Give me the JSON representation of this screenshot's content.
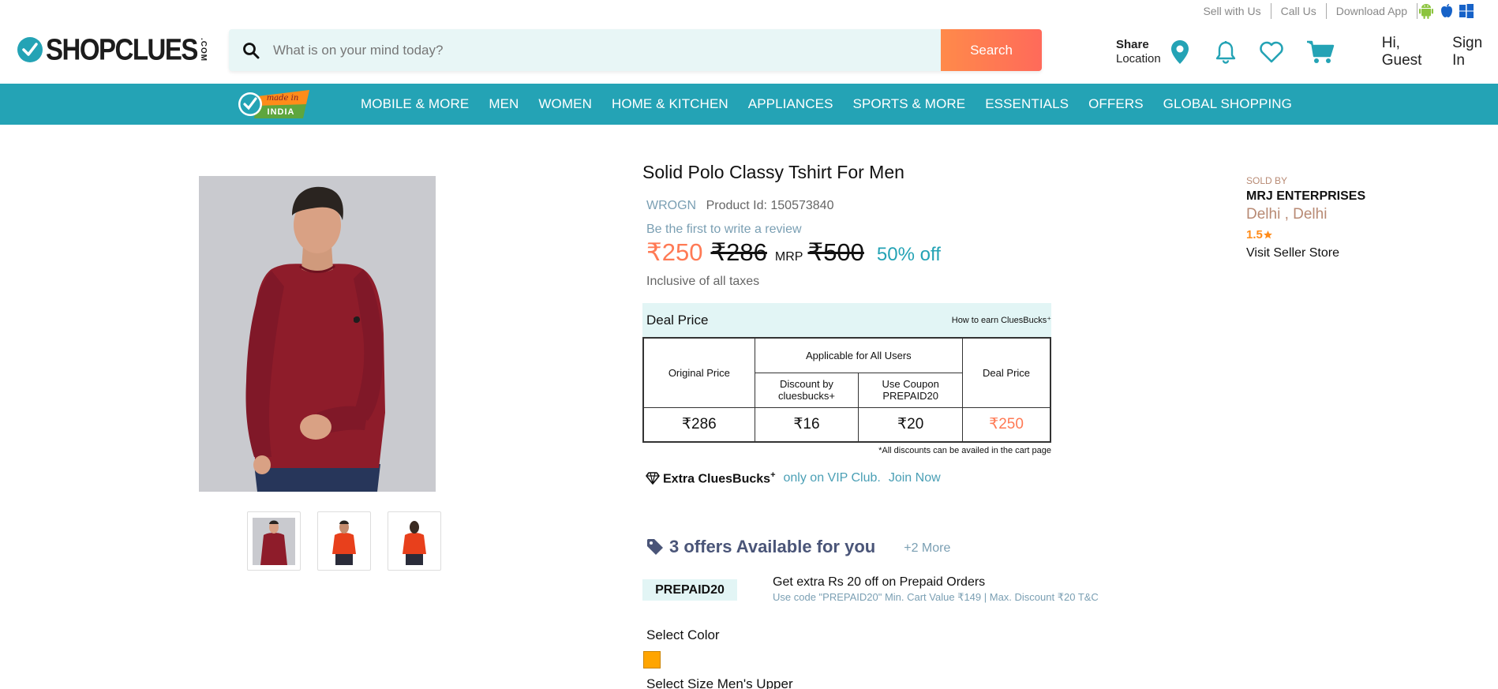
{
  "util": {
    "sell": "Sell with Us",
    "call": "Call Us",
    "download": "Download App"
  },
  "logo": {
    "word": "SHOPCLUES",
    "com": ".COM"
  },
  "search": {
    "placeholder": "What is on your mind today?",
    "button": "Search"
  },
  "header": {
    "share_title": "Share",
    "share_sub": "Location",
    "greeting": "Hi, Guest",
    "signin": "Sign In"
  },
  "nav": {
    "badge_top": "made in",
    "badge_bottom": "INDIA",
    "items": [
      "MOBILE & MORE",
      "MEN",
      "WOMEN",
      "HOME & KITCHEN",
      "APPLIANCES",
      "SPORTS & MORE",
      "ESSENTIALS",
      "OFFERS",
      "GLOBAL SHOPPING"
    ]
  },
  "product": {
    "title": "Solid Polo Classy Tshirt For Men",
    "brand": "WROGN",
    "product_id": "Product Id: 150573840",
    "review": "Be the first to write a review",
    "price": "₹250",
    "strike_price": "₹286",
    "mrp_label": "MRP",
    "mrp": "₹500",
    "discount": "50% off",
    "tax_note": "Inclusive of all taxes"
  },
  "deal": {
    "title": "Deal Price",
    "help": "How to earn CluesBucks⁺",
    "col_original": "Original Price",
    "col_applicable": "Applicable for All Users",
    "col_discount": "Discount by cluesbucks+",
    "col_coupon": "Use Coupon PREPAID20",
    "col_deal": "Deal Price",
    "val_original": "₹286",
    "val_discount": "₹16",
    "val_coupon": "₹20",
    "val_deal": "₹250",
    "note": "*All discounts can be availed in the cart page"
  },
  "vip": {
    "label": "Extra CluesBucks",
    "plus": "+",
    "only": "only on VIP Club.",
    "join": "Join Now"
  },
  "offers": {
    "title": "3 offers Available for you",
    "more": "+2 More",
    "coupon_code": "PREPAID20",
    "coupon_title": "Get extra Rs 20 off on Prepaid Orders",
    "coupon_desc": "Use code \"PREPAID20\" Min. Cart Value ₹149 | Max. Discount ₹20 T&C"
  },
  "select": {
    "color_label": "Select Color",
    "color_value": "#ffa500",
    "size_label": "Select Size Men's Upper"
  },
  "seller": {
    "sold_by": "SOLD BY",
    "name": "MRJ ENTERPRISES",
    "location": "Delhi , Delhi",
    "rating": "1.5",
    "visit": "Visit Seller Store"
  },
  "colors": {
    "brand_teal": "#24a3b5",
    "accent_orange": "#ff7a55",
    "shirt_maroon": "#8e1c2a",
    "shirt_orange": "#e8401c"
  }
}
